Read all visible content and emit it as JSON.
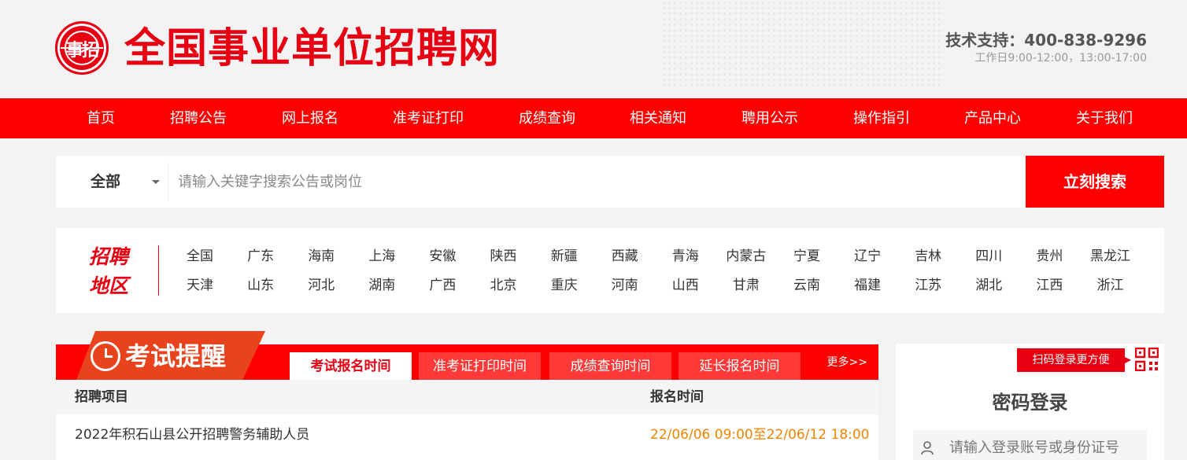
{
  "header": {
    "logo_text": "事招",
    "site_title": "全国事业单位招聘网",
    "support_tel": "技术支持：400-838-9296",
    "support_hours": "工作日9:00-12:00，13:00-17:00"
  },
  "nav": {
    "items": [
      "首页",
      "招聘公告",
      "网上报名",
      "准考证打印",
      "成绩查询",
      "相关通知",
      "聘用公示",
      "操作指引",
      "产品中心",
      "关于我们"
    ]
  },
  "search": {
    "scope_selected": "全部",
    "placeholder": "请输入关键字搜索公告或岗位",
    "value": "",
    "button_label": "立刻搜索"
  },
  "regions": {
    "label": "招聘地区",
    "row1": [
      "全国",
      "广东",
      "海南",
      "上海",
      "安徽",
      "陕西",
      "新疆",
      "西藏",
      "青海",
      "内蒙古",
      "宁夏",
      "辽宁",
      "吉林",
      "四川",
      "贵州",
      "黑龙江"
    ],
    "row2": [
      "天津",
      "山东",
      "河北",
      "湖南",
      "广西",
      "北京",
      "重庆",
      "河南",
      "山西",
      "甘肃",
      "云南",
      "福建",
      "江苏",
      "湖北",
      "江西",
      "浙江"
    ]
  },
  "exam": {
    "title": "考试提醒",
    "tabs": [
      {
        "label": "考试报名时间",
        "active": true
      },
      {
        "label": "准考证打印时间",
        "active": false
      },
      {
        "label": "成绩查询时间",
        "active": false
      },
      {
        "label": "延长报名时间",
        "active": false
      }
    ],
    "more": "更多>>",
    "columns": [
      "招聘项目",
      "报名时间"
    ],
    "rows": [
      {
        "project": "2022年积石山县公开招聘警务辅助人员",
        "time": "22/06/06 09:00至22/06/12 18:00"
      }
    ]
  },
  "login": {
    "qr_tip": "扫码登录更方便",
    "title": "密码登录",
    "account_placeholder": "请输入登录账号或身份证号"
  },
  "colors": {
    "brand_red": "#ff0000",
    "badge_orange": "#e8431d",
    "time_orange": "#f08300"
  },
  "icons": [
    "logo-seal-icon",
    "caret-down-icon",
    "clock-icon",
    "qr-code-icon",
    "user-icon"
  ]
}
